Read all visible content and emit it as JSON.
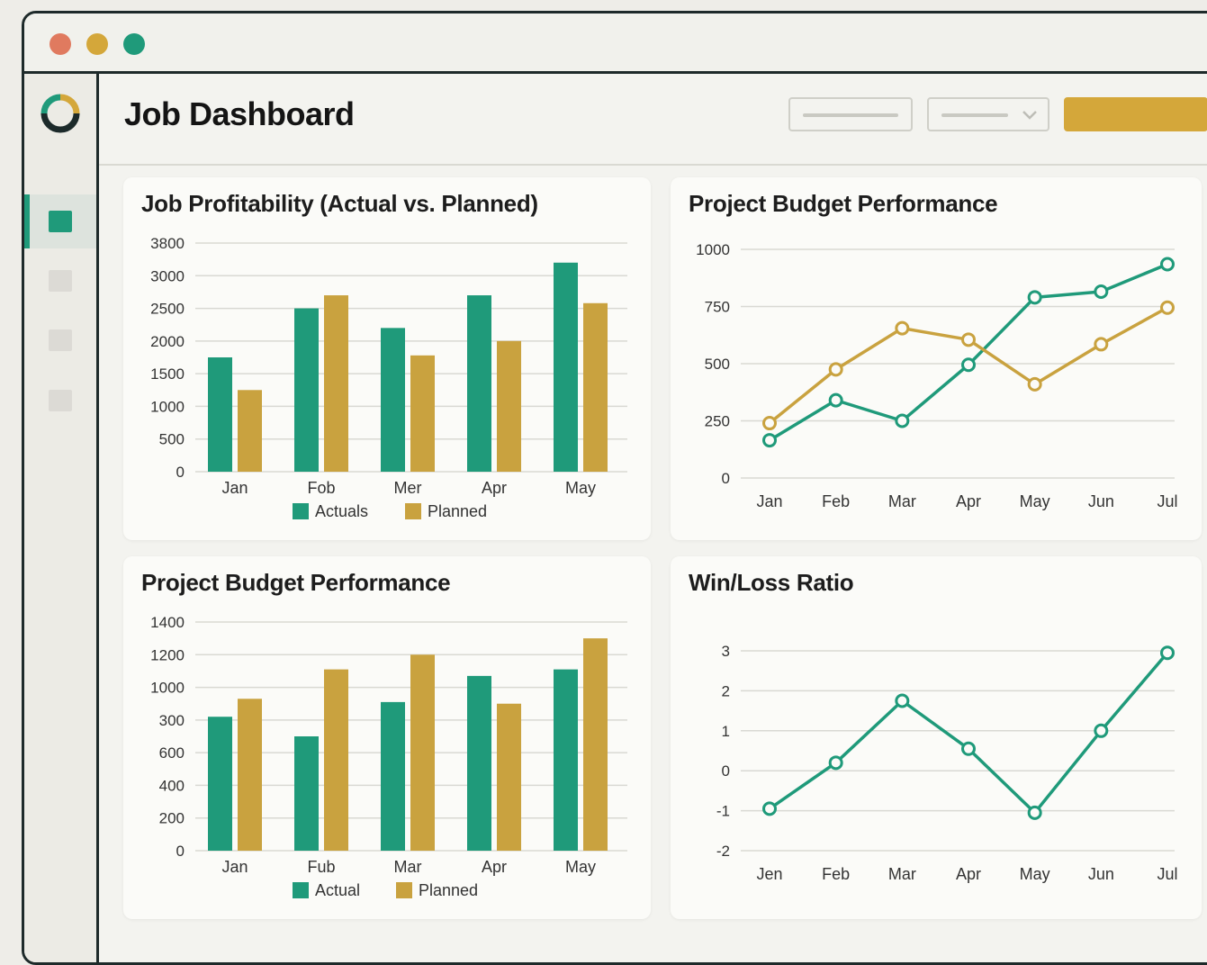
{
  "app": {
    "page_title": "Job Dashboard",
    "window_controls": [
      "close",
      "minimize",
      "maximize"
    ],
    "colors": {
      "close": "#e07a5f",
      "minimize": "#d4a73a",
      "maximize": "#1f9a7a",
      "teal": "#1f9a7a",
      "gold": "#c9a23f",
      "grid": "#d6d6d0"
    }
  },
  "sidebar": {
    "logo_icon": "ring-logo-icon",
    "items": [
      {
        "name": "nav-item-1",
        "active": true
      },
      {
        "name": "nav-item-2",
        "active": false
      },
      {
        "name": "nav-item-3",
        "active": false
      },
      {
        "name": "nav-item-4",
        "active": false
      }
    ]
  },
  "header": {
    "controls": [
      "text-button",
      "dropdown-select",
      "primary-action-button"
    ]
  },
  "chart_data": [
    {
      "id": "profitability",
      "type": "bar",
      "title": "Job Profitability (Actual vs. Planned)",
      "categories": [
        "Jan",
        "Fob",
        "Mer",
        "Apr",
        "May"
      ],
      "series": [
        {
          "name": "Actuals",
          "color": "#1f9a7a",
          "values": [
            1750,
            2500,
            2200,
            2700,
            3200
          ]
        },
        {
          "name": "Planned",
          "color": "#c9a23f",
          "values": [
            1250,
            2700,
            1780,
            2000,
            2580
          ]
        }
      ],
      "yticks": [
        "0",
        "500",
        "1000",
        "1500",
        "2000",
        "2500",
        "3000",
        "3800"
      ],
      "ylim": [
        0,
        3500
      ],
      "legend": "bottom"
    },
    {
      "id": "budget-line",
      "type": "line",
      "title": "Project Budget Performance",
      "categories": [
        "Jan",
        "Feb",
        "Mar",
        "Apr",
        "May",
        "Jun",
        "Jul"
      ],
      "series": [
        {
          "color": "#1f9a7a",
          "values": [
            165,
            340,
            250,
            495,
            790,
            815,
            935
          ]
        },
        {
          "color": "#c9a23f",
          "values": [
            240,
            475,
            655,
            605,
            410,
            585,
            745
          ]
        }
      ],
      "yticks": [
        "0",
        "250",
        "500",
        "750",
        "1000"
      ],
      "ylim": [
        0,
        1000
      ]
    },
    {
      "id": "budget-bar",
      "type": "bar",
      "title": "Project Budget Performance",
      "categories": [
        "Jan",
        "Fub",
        "Mar",
        "Apr",
        "May"
      ],
      "series": [
        {
          "name": "Actual",
          "color": "#1f9a7a",
          "values": [
            820,
            700,
            910,
            1070,
            1110
          ]
        },
        {
          "name": "Planned",
          "color": "#c9a23f",
          "values": [
            930,
            1110,
            1200,
            900,
            1300
          ]
        }
      ],
      "yticks": [
        "0",
        "200",
        "400",
        "600",
        "300",
        "1000",
        "1200",
        "1400"
      ],
      "ylim": [
        0,
        1400
      ],
      "legend": "bottom"
    },
    {
      "id": "winloss",
      "type": "line",
      "title": "Win/Loss Ratio",
      "categories": [
        "Jen",
        "Feb",
        "Mar",
        "Apr",
        "May",
        "Jun",
        "Jul"
      ],
      "series": [
        {
          "color": "#1f9a7a",
          "values": [
            -0.95,
            0.2,
            1.75,
            0.55,
            -1.05,
            1.0,
            2.95
          ]
        }
      ],
      "yticks": [
        "-2",
        "-1",
        "0",
        "1",
        "2",
        "3"
      ],
      "ylim": [
        -2,
        3
      ]
    }
  ]
}
